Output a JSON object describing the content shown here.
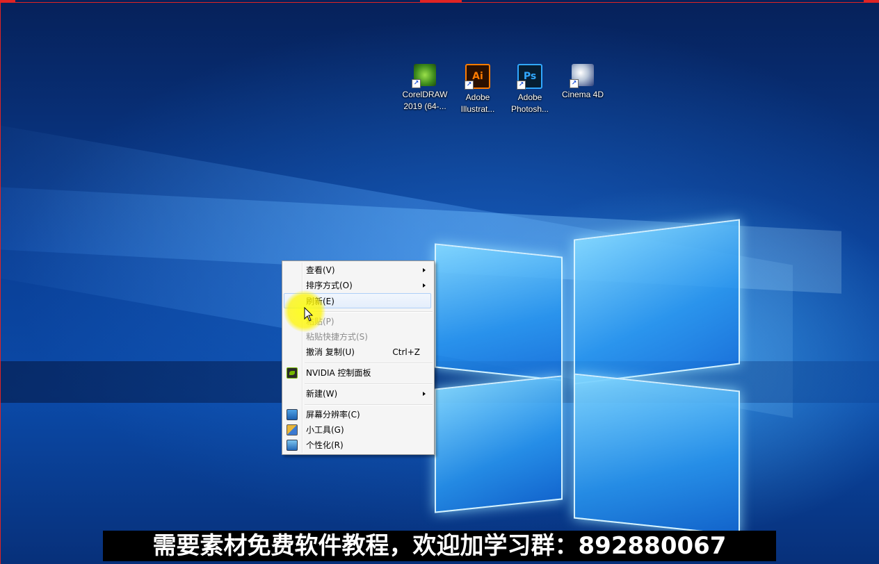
{
  "desktop": {
    "icons": [
      {
        "name": "coreldraw-icon",
        "label_line1": "CorelDRAW",
        "label_line2": "2019 (64-...",
        "glyph": "",
        "shortcut": "↗"
      },
      {
        "name": "illustrator-icon",
        "label_line1": "Adobe",
        "label_line2": "Illustrat...",
        "glyph": "Ai",
        "shortcut": "↗"
      },
      {
        "name": "photoshop-icon",
        "label_line1": "Adobe",
        "label_line2": "Photosh...",
        "glyph": "Ps",
        "shortcut": "↗"
      },
      {
        "name": "cinema4d-icon",
        "label_line1": "Cinema 4D",
        "label_line2": "",
        "glyph": "",
        "shortcut": "↗"
      }
    ]
  },
  "context_menu": {
    "items": [
      {
        "label": "查看(V)",
        "submenu": true
      },
      {
        "label": "排序方式(O)",
        "submenu": true
      },
      {
        "label": "刷新(E)",
        "highlighted": true
      },
      {
        "label": "粘贴(P)",
        "disabled": true
      },
      {
        "label": "粘贴快捷方式(S)",
        "disabled": true
      },
      {
        "label": "撤消 复制(U)",
        "shortcut": "Ctrl+Z"
      },
      {
        "label": "NVIDIA 控制面板",
        "icon": "nvidia-icon"
      },
      {
        "label": "新建(W)",
        "submenu": true
      },
      {
        "label": "屏幕分辨率(C)",
        "icon": "screen-resolution-icon"
      },
      {
        "label": "小工具(G)",
        "icon": "gadgets-icon"
      },
      {
        "label": "个性化(R)",
        "icon": "personalize-icon"
      }
    ]
  },
  "caption": {
    "text": "需要素材免费软件教程，欢迎加学习群：892880067"
  },
  "colors": {
    "recording_frame": "#e02424",
    "wallpaper_blue": "#0b4aa8",
    "menu_background": "#f5f5f5",
    "cursor_highlight": "#ffff00"
  }
}
